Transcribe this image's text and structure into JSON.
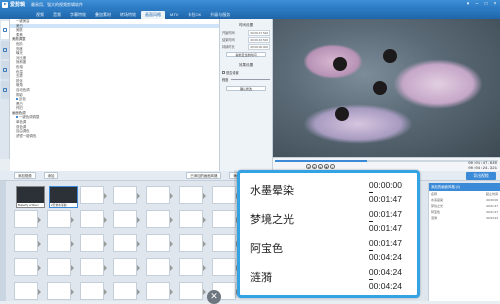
{
  "app": {
    "title": "爱剪辑",
    "tagline": "最易用、强大的视频剪辑软件"
  },
  "tabs": [
    "视频",
    "音频",
    "字幕特效",
    "叠加素材",
    "转场特效",
    "画面风格",
    "MTV",
    "卡拉OK",
    "升级与服务"
  ],
  "active_tab": "画面风格",
  "effect_list": [
    {
      "label": "一键美容",
      "type": "item"
    },
    {
      "label": "美白",
      "type": "item",
      "selected": true
    },
    {
      "label": "美肤",
      "type": "item"
    },
    {
      "label": "柔焦",
      "type": "item"
    },
    {
      "label": "美颜调整",
      "type": "group"
    },
    {
      "label": "色阶",
      "type": "item"
    },
    {
      "label": "亮度",
      "type": "item"
    },
    {
      "label": "曝光",
      "type": "item"
    },
    {
      "label": "对比度",
      "type": "item"
    },
    {
      "label": "饱和度",
      "type": "item"
    },
    {
      "label": "色相",
      "type": "item"
    },
    {
      "label": "色温",
      "type": "item"
    },
    {
      "label": "去雾",
      "type": "item"
    },
    {
      "label": "锐化",
      "type": "item"
    },
    {
      "label": "暗角",
      "type": "item"
    },
    {
      "label": "自动色调",
      "type": "item"
    },
    {
      "label": "阴影",
      "type": "item"
    },
    {
      "label": "反色",
      "type": "item",
      "marked": true
    },
    {
      "label": "黑白",
      "type": "item"
    },
    {
      "label": "怀旧",
      "type": "item"
    },
    {
      "label": "画面色调",
      "type": "group"
    },
    {
      "label": "一键色调调整",
      "type": "item",
      "marked": true
    },
    {
      "label": "单色调",
      "type": "item"
    },
    {
      "label": "双色调",
      "type": "item"
    },
    {
      "label": "自由调色",
      "type": "item"
    },
    {
      "label": "滤镜一键调色",
      "type": "item"
    }
  ],
  "settings": {
    "section1": "时间设置",
    "rows": [
      {
        "label": "开始时间",
        "value": "00:00:47.526"
      },
      {
        "label": "结束时间",
        "value": "00:00:46.526"
      },
      {
        "label": "持续时长",
        "value": "00:00:00.000"
      }
    ],
    "button1": "提前至当前时间",
    "section2": "效果设置",
    "check1": "是否设置",
    "check2": "程度",
    "slider_label": "程度",
    "button2": "确认修改"
  },
  "playback": {
    "current": "00:01:47.640",
    "total": "00:04:24.321",
    "speed": "1.0"
  },
  "addbar": {
    "add_video": "添加视频",
    "add_audio": "添加",
    "effects": "已添加的画面风格",
    "confirm": "确认"
  },
  "export_label": "导出视频",
  "clips": [
    {
      "label": "Butterfly of River",
      "selected": false
    },
    {
      "label": "2天堂水墨韵",
      "selected": true
    }
  ],
  "right_panel": {
    "title": "添加的画面风格 (4)",
    "header_name": "名称",
    "header_time": "起止时间",
    "rows": [
      {
        "name": "水墨晕染",
        "t1": "00:00:00",
        "t2": "00:01:47"
      },
      {
        "name": "梦境之光",
        "t1": "00:01:47",
        "t2": "00:01:47"
      },
      {
        "name": "阿宝色",
        "t1": "00:01:47",
        "t2": "00:04:24"
      },
      {
        "name": "涟漪",
        "t1": "00:04:24",
        "t2": "00:04:24"
      }
    ]
  },
  "zoom_rows": [
    {
      "name": "水墨晕染",
      "t1": "00:00:00",
      "t2": "00:01:47"
    },
    {
      "name": "梦境之光",
      "t1": "00:01:47",
      "t2": "00:01:47"
    },
    {
      "name": "阿宝色",
      "t1": "00:01:47",
      "t2": "00:04:24"
    },
    {
      "name": "涟漪",
      "t1": "00:04:24",
      "t2": "00:04:24"
    }
  ],
  "close_symbol": "✕",
  "colors": {
    "accent": "#3a8ad8",
    "titlebar": "#2a78c2",
    "zoom_border": "#33a3e3"
  }
}
